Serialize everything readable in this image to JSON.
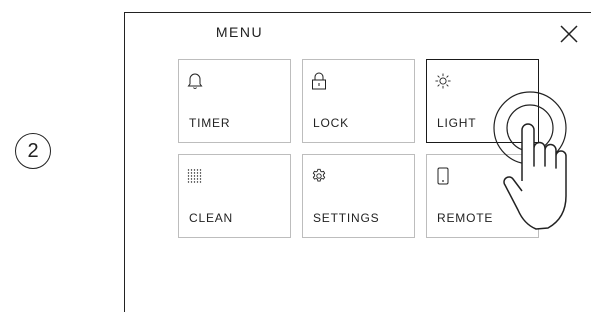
{
  "step": {
    "number": "2"
  },
  "screen": {
    "title": "MENU",
    "close_icon": "close-icon",
    "tiles": [
      {
        "id": "timer",
        "label": "TIMER",
        "icon": "bell-icon",
        "selected": false
      },
      {
        "id": "lock",
        "label": "LOCK",
        "icon": "lock-icon",
        "selected": false
      },
      {
        "id": "light",
        "label": "LIGHT",
        "icon": "sun-icon",
        "selected": true
      },
      {
        "id": "clean",
        "label": "CLEAN",
        "icon": "dot-grid-icon",
        "selected": false
      },
      {
        "id": "settings",
        "label": "SETTINGS",
        "icon": "gear-icon",
        "selected": false
      },
      {
        "id": "remote",
        "label": "REMOTE",
        "icon": "phone-icon",
        "selected": false
      }
    ]
  },
  "gesture": {
    "icon": "tap-hand-icon"
  },
  "colors": {
    "line": "#222222",
    "tile_border": "#bdbdbd",
    "selected_border": "#1a1a1a"
  }
}
